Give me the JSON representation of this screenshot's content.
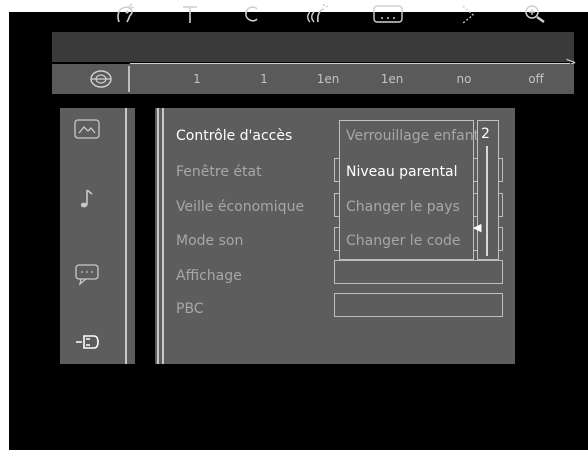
{
  "icon_bar": {
    "icons": [
      "character-icon",
      "title-icon",
      "chapter-icon",
      "audio-icon",
      "subtitle-icon",
      "angle-icon",
      "zoom-icon"
    ]
  },
  "values_bar": {
    "values": [
      "1",
      "1",
      "1en",
      "1en",
      "no",
      "off"
    ]
  },
  "side_menu": {
    "icons": [
      "picture-icon",
      "music-note-icon",
      "subtitle-speech-icon",
      "settings-plug-icon"
    ],
    "selected_index": 3
  },
  "main_menu": {
    "items": [
      "Contrôle d'accès",
      "Fenêtre état",
      "Veille économique",
      "Mode son",
      "Affichage",
      "PBC"
    ],
    "selected_index": 0
  },
  "submenu": {
    "items": [
      "Verrouillage enfant",
      "Niveau parental",
      "Changer le pays",
      "Changer le code"
    ],
    "selected_index": 1
  },
  "parental_level": {
    "value": "2"
  },
  "colors": {
    "background": "#000000",
    "panel": "#5d5d5d",
    "text_active": "#ffffff",
    "text_inactive": "#a7a7a7"
  }
}
